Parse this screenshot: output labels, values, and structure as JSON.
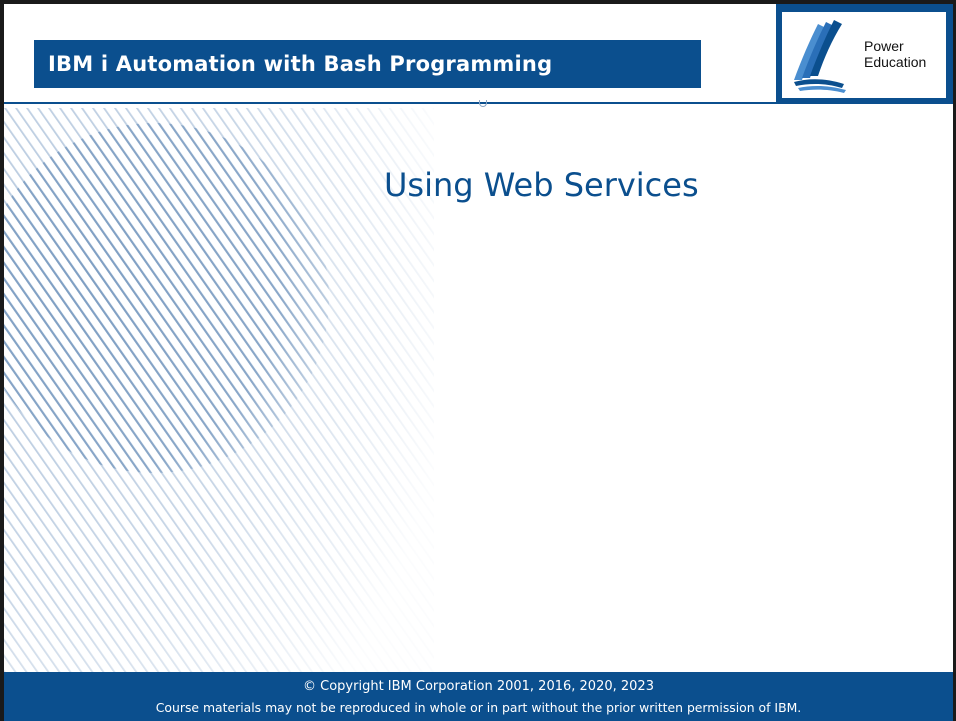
{
  "header": {
    "course_title": "IBM i Automation with Bash Programming",
    "logo": {
      "icon": "book-pages-icon",
      "line1": "Power",
      "line2": "Education"
    }
  },
  "slide": {
    "title": "Using Web Services"
  },
  "footer": {
    "copyright": "© Copyright IBM Corporation 2001, 2016, 2020, 2023",
    "disclaimer": "Course materials may not be reproduced in whole or in part without the prior written permission of IBM."
  },
  "colors": {
    "brand_blue": "#0b4f8e",
    "stripe_blue": "#9db8d6",
    "text_white": "#ffffff"
  }
}
